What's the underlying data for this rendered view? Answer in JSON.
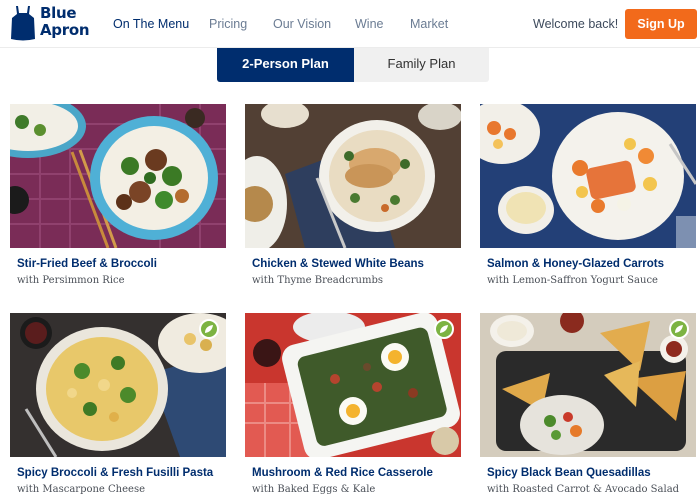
{
  "header": {
    "brand_line1": "Blue",
    "brand_line2": "Apron",
    "nav": [
      {
        "label": "On The Menu",
        "active": true
      },
      {
        "label": "Pricing"
      },
      {
        "label": "Our Vision"
      },
      {
        "label": "Wine"
      },
      {
        "label": "Market"
      }
    ],
    "welcome": "Welcome back!",
    "signup": "Sign Up"
  },
  "plans": {
    "selected": "2-Person Plan",
    "other": "Family Plan"
  },
  "colors": {
    "brand_blue": "#002d6e",
    "cta_orange": "#f26a1b",
    "veg_badge": "#7cb342"
  },
  "recipes": [
    {
      "title": "Stir-Fried Beef & Broccoli",
      "subtitle": "with Persimmon Rice",
      "vegetarian": false
    },
    {
      "title": "Chicken & Stewed White Beans",
      "subtitle": "with Thyme Breadcrumbs",
      "vegetarian": false
    },
    {
      "title": "Salmon & Honey-Glazed Carrots",
      "subtitle": "with Lemon-Saffron Yogurt Sauce",
      "vegetarian": false
    },
    {
      "title": "Spicy Broccoli & Fresh Fusilli Pasta",
      "subtitle": "with Mascarpone Cheese",
      "vegetarian": true,
      "badge_icon": "leaf-icon"
    },
    {
      "title": "Mushroom & Red Rice Casserole",
      "subtitle": "with Baked Eggs & Kale",
      "vegetarian": true,
      "badge_icon": "leaf-icon"
    },
    {
      "title": "Spicy Black Bean Quesadillas",
      "subtitle": "with Roasted Carrot & Avocado Salad",
      "vegetarian": true,
      "badge_icon": "leaf-icon"
    }
  ]
}
